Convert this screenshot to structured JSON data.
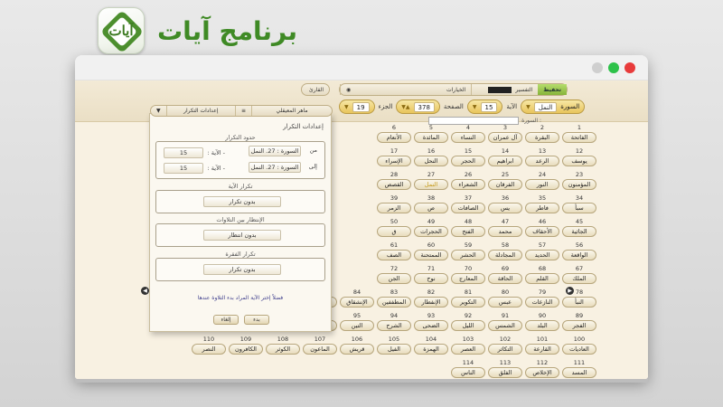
{
  "brand": {
    "title": "برنامج آيات",
    "icon_text": "آيات"
  },
  "window": {
    "dots": [
      "#cfcfcf",
      "#2ec24a",
      "#e83b3b"
    ]
  },
  "header": {
    "toolbar_right": {
      "recite": "تحفيظ",
      "tafsir": "التفسير",
      "choices": "الخيارات"
    },
    "toolbar_left": {
      "recitation": "القارئ",
      "reciter": "ماهر المعيقلي",
      "repeat_settings": "إعدادات التكرار"
    },
    "sura_label": "السورة",
    "sura_value": "النمل",
    "aya_label": "الآية",
    "aya_value": "15",
    "page_label": "الصفحة",
    "page_value": "378",
    "juz_label": "الجزء",
    "juz_value": "19",
    "search_label": "السورة :"
  },
  "panel": {
    "title": "إعدادات التكرار",
    "range_title": "حدود التكرار",
    "from_label": "من",
    "to_label": "إلى",
    "from_sura": "السورة : 27. النمل",
    "from_aya": "- الآية :",
    "from_aya_val": "15",
    "to_sura": "السورة : 27. النمل",
    "to_aya": "- الآية :",
    "to_aya_val": "15",
    "aya_repeat_title": "تكرار الآية",
    "aya_repeat_value": "بدون تكرار",
    "wait_title": "الإنتظار بين التلاوات",
    "wait_value": "بدون انتظار",
    "passage_repeat_title": "تكرار الفقرة",
    "passage_repeat_value": "بدون تكرار",
    "hint": "فضلاً إختر الآية المراد بدء التلاوة عندها",
    "start_button": "بدء",
    "cancel_button": "إلغاء"
  },
  "surahs": [
    {
      "n": "1",
      "name": "الفاتحة"
    },
    {
      "n": "2",
      "name": "البقرة"
    },
    {
      "n": "3",
      "name": "آل عمران"
    },
    {
      "n": "4",
      "name": "النساء"
    },
    {
      "n": "5",
      "name": "المائدة"
    },
    {
      "n": "6",
      "name": "الأنعام"
    },
    {
      "n": "12",
      "name": "يوسف"
    },
    {
      "n": "13",
      "name": "الرعد"
    },
    {
      "n": "14",
      "name": "ابراهيم"
    },
    {
      "n": "15",
      "name": "الحجر"
    },
    {
      "n": "16",
      "name": "النحل"
    },
    {
      "n": "17",
      "name": "الإسراء"
    },
    {
      "n": "23",
      "name": "المؤمنون"
    },
    {
      "n": "24",
      "name": "النور"
    },
    {
      "n": "25",
      "name": "الفرقان"
    },
    {
      "n": "26",
      "name": "الشعراء"
    },
    {
      "n": "27",
      "name": "النمل"
    },
    {
      "n": "28",
      "name": "القصص"
    },
    {
      "n": "34",
      "name": "سبأ"
    },
    {
      "n": "35",
      "name": "فاطر"
    },
    {
      "n": "36",
      "name": "يس"
    },
    {
      "n": "37",
      "name": "الصافات"
    },
    {
      "n": "38",
      "name": "ص"
    },
    {
      "n": "39",
      "name": "الزمر"
    },
    {
      "n": "45",
      "name": "الجاثية"
    },
    {
      "n": "46",
      "name": "الأحقاف"
    },
    {
      "n": "47",
      "name": "محمد"
    },
    {
      "n": "48",
      "name": "الفتح"
    },
    {
      "n": "49",
      "name": "الحجرات"
    },
    {
      "n": "50",
      "name": "ق"
    },
    {
      "n": "56",
      "name": "الواقعة"
    },
    {
      "n": "57",
      "name": "الحديد"
    },
    {
      "n": "58",
      "name": "المجادلة"
    },
    {
      "n": "59",
      "name": "الحشر"
    },
    {
      "n": "60",
      "name": "الممتحنة"
    },
    {
      "n": "61",
      "name": "الصف"
    },
    {
      "n": "67",
      "name": "الملك"
    },
    {
      "n": "68",
      "name": "القلم"
    },
    {
      "n": "69",
      "name": "الحاقة"
    },
    {
      "n": "70",
      "name": "المعارج"
    },
    {
      "n": "71",
      "name": "نوح"
    },
    {
      "n": "72",
      "name": "الجن"
    },
    {
      "n": "78",
      "name": "النبأ"
    },
    {
      "n": "79",
      "name": "النازعات"
    },
    {
      "n": "80",
      "name": "عبس"
    },
    {
      "n": "81",
      "name": "التكوير"
    },
    {
      "n": "82",
      "name": "الإنفطار"
    },
    {
      "n": "83",
      "name": "المطففين"
    },
    {
      "n": "84",
      "name": "الإنشقاق"
    },
    {
      "n": "85",
      "name": "البروج"
    },
    {
      "n": "86",
      "name": "الطارق"
    },
    {
      "n": "87",
      "name": "الأعلى"
    },
    {
      "n": "88",
      "name": "الغاشية"
    },
    {
      "n": "89",
      "name": "الفجر"
    },
    {
      "n": "90",
      "name": "البلد"
    },
    {
      "n": "91",
      "name": "الشمس"
    },
    {
      "n": "92",
      "name": "الليل"
    },
    {
      "n": "93",
      "name": "الضحى"
    },
    {
      "n": "94",
      "name": "الشرح"
    },
    {
      "n": "95",
      "name": "التين"
    },
    {
      "n": "96",
      "name": "العلق"
    },
    {
      "n": "97",
      "name": "القدر"
    },
    {
      "n": "98",
      "name": "البينة"
    },
    {
      "n": "99",
      "name": "الزلزلة"
    },
    {
      "n": "100",
      "name": "العاديات"
    },
    {
      "n": "101",
      "name": "القارعة"
    },
    {
      "n": "102",
      "name": "التكاثر"
    },
    {
      "n": "103",
      "name": "العصر"
    },
    {
      "n": "104",
      "name": "الهمزة"
    },
    {
      "n": "105",
      "name": "الفيل"
    },
    {
      "n": "106",
      "name": "قريش"
    },
    {
      "n": "107",
      "name": "الماعون"
    },
    {
      "n": "108",
      "name": "الكوثر"
    },
    {
      "n": "109",
      "name": "الكافرون"
    },
    {
      "n": "110",
      "name": "النصر"
    },
    {
      "n": "111",
      "name": "المسد"
    },
    {
      "n": "112",
      "name": "الإخلاص"
    },
    {
      "n": "113",
      "name": "الفلق"
    },
    {
      "n": "114",
      "name": "الناس"
    }
  ]
}
